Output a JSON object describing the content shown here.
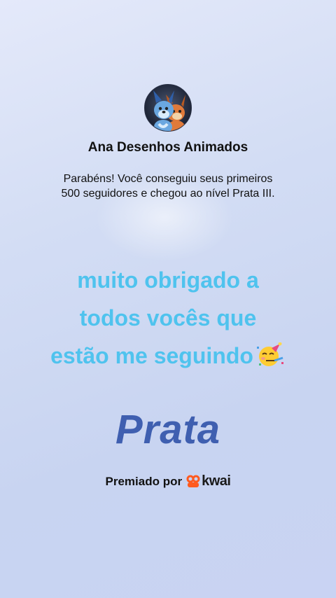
{
  "profile": {
    "channel_name": "Ana Desenhos Animados",
    "message_line1": "Parabéns! Você conseguiu seus primeiros",
    "message_line2": "500 seguidores e chegou ao nível Prata III."
  },
  "caption": {
    "line1": "muito obrigado a",
    "line2": "todos vocês que",
    "line3": "estão me seguindo",
    "emoji": "partying-face-icon"
  },
  "level": {
    "label": "Prata"
  },
  "award": {
    "prefix": "Premiado por",
    "brand": "kwai",
    "brand_icon": "kwai-logo-icon"
  },
  "colors": {
    "caption": "#4fc3ee",
    "level": "#3f5fb0",
    "brand_accent": "#ff5a1f"
  }
}
